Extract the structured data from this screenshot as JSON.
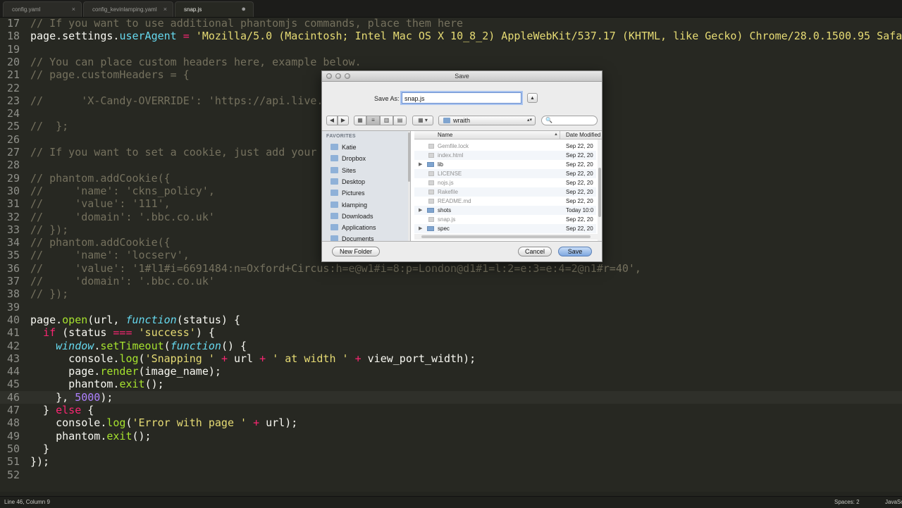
{
  "tabs": [
    {
      "label": "config.yaml",
      "close": "×",
      "active": false
    },
    {
      "label": "config_kevinlamping.yaml",
      "close": "×",
      "active": false
    },
    {
      "label": "snap.js",
      "close": "●",
      "active": true
    }
  ],
  "code": {
    "lines": [
      {
        "num": "17",
        "text": "// If you want to use additional phantomjs commands, place them here"
      },
      {
        "num": "18",
        "text": "page.settings.userAgent = 'Mozilla/5.0 (Macintosh; Intel Mac OS X 10_8_2) AppleWebKit/537.17 (KHTML, like Gecko) Chrome/28.0.1500.95 Safa"
      },
      {
        "num": "19",
        "text": ""
      },
      {
        "num": "20",
        "text": "// You can place custom headers here, example below."
      },
      {
        "num": "21",
        "text": "// page.customHeaders = {"
      },
      {
        "num": "22",
        "text": ""
      },
      {
        "num": "23",
        "text": "//      'X-Candy-OVERRIDE': 'https://api.live."
      },
      {
        "num": "24",
        "text": ""
      },
      {
        "num": "25",
        "text": "//  };"
      },
      {
        "num": "26",
        "text": ""
      },
      {
        "num": "27",
        "text": "// If you want to set a cookie, just add your"
      },
      {
        "num": "28",
        "text": ""
      },
      {
        "num": "29",
        "text": "// phantom.addCookie({"
      },
      {
        "num": "30",
        "text": "//     'name': 'ckns_policy',"
      },
      {
        "num": "31",
        "text": "//     'value': '111',"
      },
      {
        "num": "32",
        "text": "//     'domain': '.bbc.co.uk'"
      },
      {
        "num": "33",
        "text": "// });"
      },
      {
        "num": "34",
        "text": "// phantom.addCookie({"
      },
      {
        "num": "35",
        "text": "//     'name': 'locserv',"
      },
      {
        "num": "36",
        "text": "//     'value': '1#l1#i=6691484:n=Oxford+Circus:h=e@w1#i=8:p=London@d1#1=l:2=e:3=e:4=2@n1#r=40',"
      },
      {
        "num": "37",
        "text": "//     'domain': '.bbc.co.uk'"
      },
      {
        "num": "38",
        "text": "// });"
      },
      {
        "num": "39",
        "text": ""
      },
      {
        "num": "40",
        "text": "page.open(url, function(status) {"
      },
      {
        "num": "41",
        "text": "  if (status === 'success') {"
      },
      {
        "num": "42",
        "text": "    window.setTimeout(function() {"
      },
      {
        "num": "43",
        "text": "      console.log('Snapping ' + url + ' at width ' + view_port_width);"
      },
      {
        "num": "44",
        "text": "      page.render(image_name);"
      },
      {
        "num": "45",
        "text": "      phantom.exit();"
      },
      {
        "num": "46",
        "text": "    }, 5000);"
      },
      {
        "num": "47",
        "text": "  } else {"
      },
      {
        "num": "48",
        "text": "    console.log('Error with page ' + url);"
      },
      {
        "num": "49",
        "text": "    phantom.exit();"
      },
      {
        "num": "50",
        "text": "  }"
      },
      {
        "num": "51",
        "text": "});"
      },
      {
        "num": "52",
        "text": ""
      }
    ]
  },
  "status": {
    "position": "Line 46, Column 9",
    "spaces": "Spaces: 2",
    "syntax": "JavaSc"
  },
  "dialog": {
    "title": "Save",
    "save_as_label": "Save As:",
    "filename": "snap.js",
    "expand": "▲",
    "nav_back": "◀",
    "nav_forward": "▶",
    "view_icon": "▦",
    "view_list": "≡",
    "view_columns": "▥",
    "view_flow": "▤",
    "arrange": "▦ ▾",
    "location": "wraith",
    "search_placeholder": "🔍",
    "sidebar_heading": "FAVORITES",
    "sidebar": [
      "Katie",
      "Dropbox",
      "Sites",
      "Desktop",
      "Pictures",
      "klamping",
      "Downloads",
      "Applications",
      "Documents"
    ],
    "col_name": "Name",
    "col_sort": "▲",
    "col_date": "Date Modified",
    "files": [
      {
        "name": "Gemfile.lock",
        "date": "Sep 22, 20",
        "dir": false
      },
      {
        "name": "index.html",
        "date": "Sep 22, 20",
        "dir": false
      },
      {
        "name": "lib",
        "date": "Sep 22, 20",
        "dir": true
      },
      {
        "name": "LICENSE",
        "date": "Sep 22, 20",
        "dir": false
      },
      {
        "name": "nojs.js",
        "date": "Sep 22, 20",
        "dir": false
      },
      {
        "name": "Rakefile",
        "date": "Sep 22, 20",
        "dir": false
      },
      {
        "name": "README.md",
        "date": "Sep 22, 20",
        "dir": false
      },
      {
        "name": "shots",
        "date": "Today 10:0",
        "dir": true
      },
      {
        "name": "snap.js",
        "date": "Sep 22, 20",
        "dir": false
      },
      {
        "name": "spec",
        "date": "Sep 22, 20",
        "dir": true
      }
    ],
    "disclosure": "▶",
    "new_folder": "New Folder",
    "cancel": "Cancel",
    "save": "Save"
  }
}
